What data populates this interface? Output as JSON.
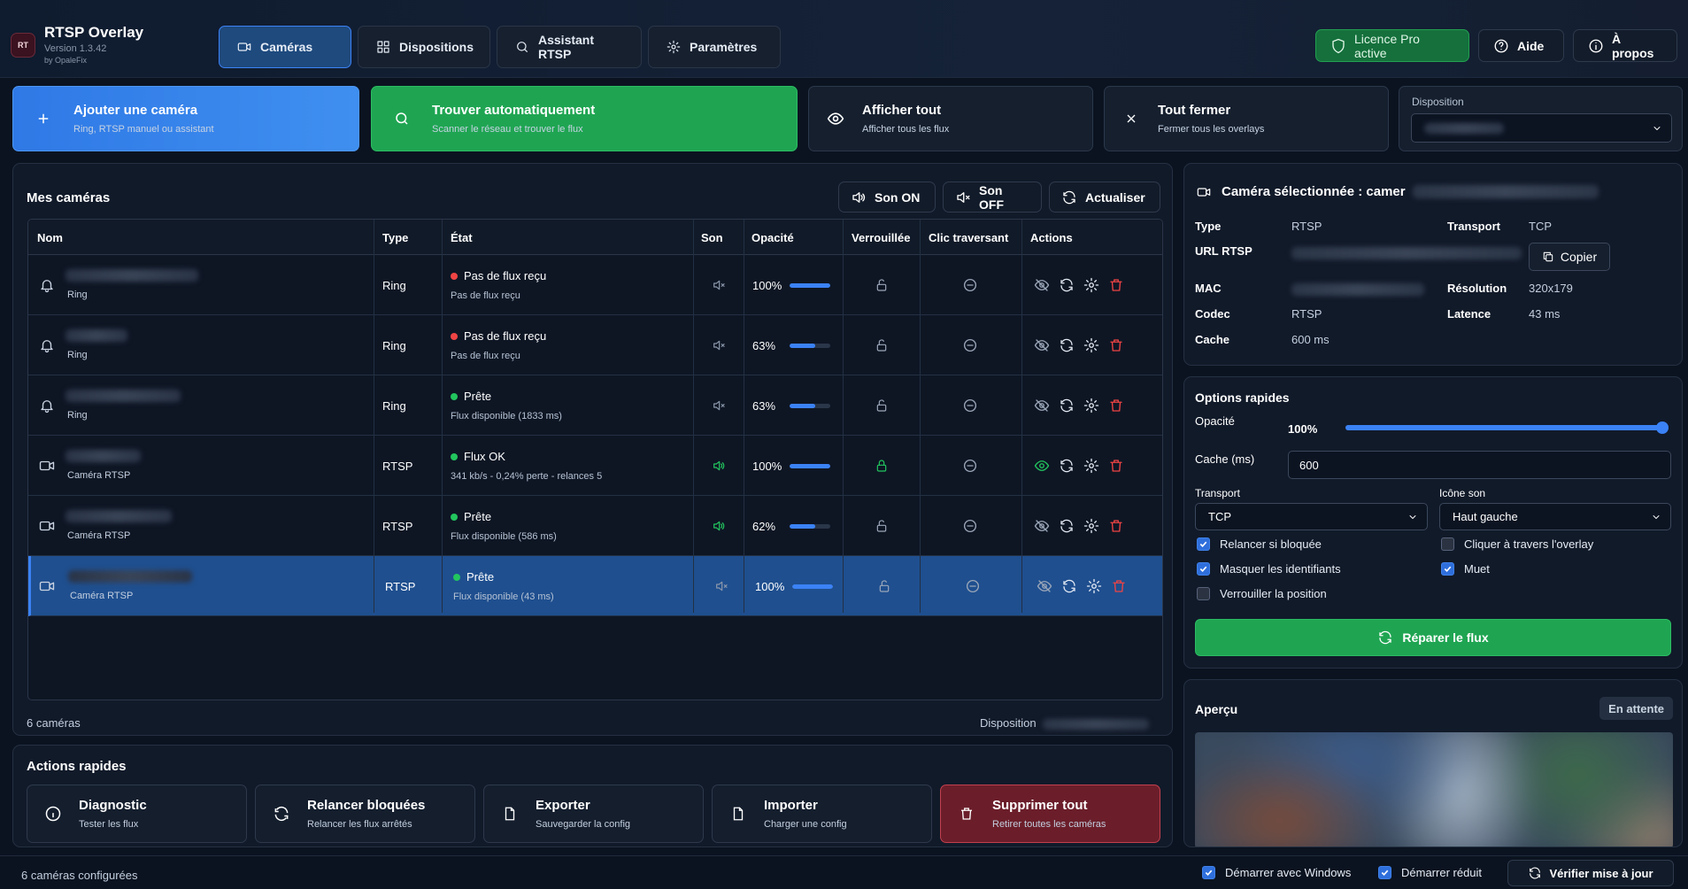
{
  "app": {
    "logo": "RT",
    "title": "RTSP Overlay",
    "version": "Version 1.3.42",
    "by": "by OpaleFix"
  },
  "nav": {
    "tabs": [
      {
        "label": "Caméras",
        "icon": "video-camera-icon",
        "active": true
      },
      {
        "label": "Dispositions",
        "icon": "grid-icon"
      },
      {
        "label": "Assistant RTSP",
        "icon": "search-icon"
      },
      {
        "label": "Paramètres",
        "icon": "gear-icon"
      }
    ]
  },
  "header_right": {
    "license": "Licence Pro active",
    "help": "Aide",
    "about": "À propos"
  },
  "actions": [
    {
      "title": "Ajouter une caméra",
      "subtitle": "Ring, RTSP manuel ou assistant",
      "icon": "plus-icon"
    },
    {
      "title": "Trouver automatiquement",
      "subtitle": "Scanner le réseau et trouver le flux",
      "icon": "search-icon"
    },
    {
      "title": "Afficher tout",
      "subtitle": "Afficher tous les flux",
      "icon": "eye-icon"
    },
    {
      "title": "Tout fermer",
      "subtitle": "Fermer tous les overlays",
      "icon": "close-icon"
    }
  ],
  "disposition": {
    "label": "Disposition"
  },
  "cameras": {
    "title": "Mes caméras",
    "buttons": {
      "sound_on": "Son ON",
      "sound_off": "Son OFF",
      "refresh": "Actualiser"
    },
    "columns": [
      "Nom",
      "Type",
      "État",
      "Son",
      "Opacité",
      "Verrouillée",
      "Clic traversant",
      "Actions"
    ],
    "rows": [
      {
        "sub": "Ring",
        "type": "Ring",
        "state": "Pas de flux reçu",
        "state_sub": "Pas de flux reçu",
        "status": "error",
        "sound": false,
        "opacity": "100%",
        "opacity_value": 1.0,
        "locked": false,
        "visible": false
      },
      {
        "sub": "Ring",
        "type": "Ring",
        "state": "Pas de flux reçu",
        "state_sub": "Pas de flux reçu",
        "status": "error",
        "sound": false,
        "opacity": "63%",
        "opacity_value": 0.63,
        "locked": false,
        "visible": false
      },
      {
        "sub": "Ring",
        "type": "Ring",
        "state": "Prête",
        "state_sub": "Flux disponible (1833 ms)",
        "status": "ok",
        "sound": false,
        "opacity": "63%",
        "opacity_value": 0.63,
        "locked": false,
        "visible": false
      },
      {
        "sub": "Caméra RTSP",
        "type": "RTSP",
        "state": "Flux OK",
        "state_sub": "341 kb/s - 0,24% perte - relances 5",
        "status": "ok",
        "sound": true,
        "opacity": "100%",
        "opacity_value": 1.0,
        "locked": true,
        "visible": true
      },
      {
        "sub": "Caméra RTSP",
        "type": "RTSP",
        "state": "Prête",
        "state_sub": "Flux disponible (586 ms)",
        "status": "ok",
        "sound": true,
        "opacity": "62%",
        "opacity_value": 0.62,
        "locked": false,
        "visible": false
      },
      {
        "sub": "Caméra RTSP",
        "type": "RTSP",
        "state": "Prête",
        "state_sub": "Flux disponible (43 ms)",
        "status": "ok",
        "sound": false,
        "opacity": "100%",
        "opacity_value": 1.0,
        "locked": false,
        "visible": false,
        "selected": true
      }
    ],
    "count": "6 caméras",
    "disposition_label": "Disposition"
  },
  "quick_actions": {
    "title": "Actions rapides",
    "items": [
      {
        "title": "Diagnostic",
        "subtitle": "Tester les flux",
        "icon": "info-icon"
      },
      {
        "title": "Relancer bloquées",
        "subtitle": "Relancer les flux arrêtés",
        "icon": "refresh-icon"
      },
      {
        "title": "Exporter",
        "subtitle": "Sauvegarder la config",
        "icon": "file-icon"
      },
      {
        "title": "Importer",
        "subtitle": "Charger une config",
        "icon": "file-icon"
      },
      {
        "title": "Supprimer tout",
        "subtitle": "Retirer toutes les caméras",
        "icon": "trash-icon"
      }
    ]
  },
  "selected_camera": {
    "title": "Caméra sélectionnée : camer",
    "type_label": "Type",
    "type": "RTSP",
    "transport_label": "Transport",
    "transport": "TCP",
    "url_label": "URL RTSP",
    "copy": "Copier",
    "mac_label": "MAC",
    "resolution_label": "Résolution",
    "resolution": "320x179",
    "codec_label": "Codec",
    "codec": "RTSP",
    "latency_label": "Latence",
    "latency": "43 ms",
    "cache_label": "Cache",
    "cache": "600 ms"
  },
  "options": {
    "title": "Options rapides",
    "opacity_label": "Opacité",
    "opacity": "100%",
    "opacity_value": 1.0,
    "cache_label": "Cache (ms)",
    "cache_value": "600",
    "transport_label": "Transport",
    "transport_value": "TCP",
    "sound_icon_label": "Icône son",
    "sound_icon_value": "Haut gauche",
    "checks": [
      {
        "label": "Relancer si bloquée",
        "checked": true
      },
      {
        "label": "Cliquer à travers l'overlay",
        "checked": false
      },
      {
        "label": "Masquer les identifiants",
        "checked": true
      },
      {
        "label": "Muet",
        "checked": true
      },
      {
        "label": "Verrouiller la position",
        "checked": false
      }
    ],
    "repair": "Réparer le flux"
  },
  "preview": {
    "title": "Aperçu",
    "badge": "En attente"
  },
  "statusbar": {
    "text": "6 caméras configurées",
    "start_windows": "Démarrer avec Windows",
    "start_reduced": "Démarrer réduit",
    "update": "Vérifier mise à jour"
  },
  "colors": {
    "accent": "#3b82f6",
    "green": "#1fa552",
    "danger": "#ef4444",
    "ok": "#22c55e",
    "bg": "#0b1320"
  }
}
